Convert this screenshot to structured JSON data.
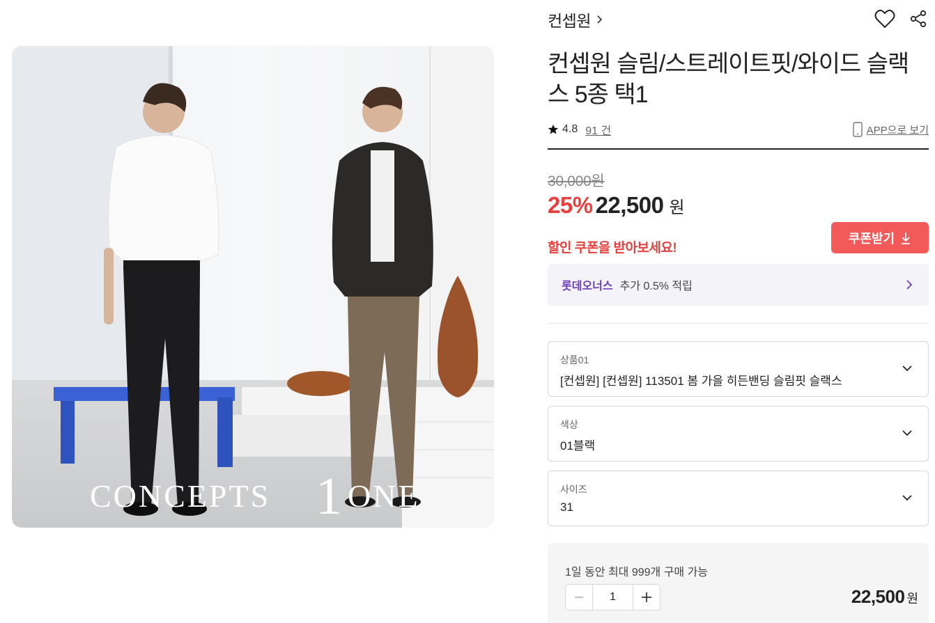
{
  "product": {
    "brand": "컨셉원",
    "title": "컨셉원 슬림/스트레이트핏/와이드 슬랙스 5종 택1",
    "image_brand_text_left": "CONCEPTS",
    "image_brand_text_mid": "1",
    "image_brand_text_right": "ONE"
  },
  "rating": {
    "score": "4.8",
    "count": "91 건"
  },
  "app_link": "APP으로 보기",
  "pricing": {
    "original": "30,000원",
    "discount": "25%",
    "price": "22,500",
    "unit": "원"
  },
  "coupon": {
    "message": "할인 쿠폰을 받아보세요!",
    "button_label": "쿠폰받기"
  },
  "points": {
    "brand": "롯데오너스",
    "desc": "추가 0.5% 적립"
  },
  "options": [
    {
      "label": "상품01",
      "value": "[컨셉원] [컨셉원] 113501 봄 가을 히든밴딩 슬림핏 슬랙스"
    },
    {
      "label": "색상",
      "value": "01블랙"
    },
    {
      "label": "사이즈",
      "value": "31"
    }
  ],
  "purchase": {
    "limit": "1일 동안 최대 999개 구매 가능",
    "quantity": "1",
    "total": "22,500",
    "unit": "원"
  },
  "colors": {
    "accent_red": "#e8403e",
    "coupon_button": "#f25a5a",
    "points_purple": "#6b3fb5"
  },
  "icons": [
    "chevron-right-icon",
    "heart-icon",
    "share-icon",
    "star-icon",
    "mobile-icon",
    "download-icon",
    "chevron-down-icon",
    "minus-icon",
    "plus-icon"
  ]
}
